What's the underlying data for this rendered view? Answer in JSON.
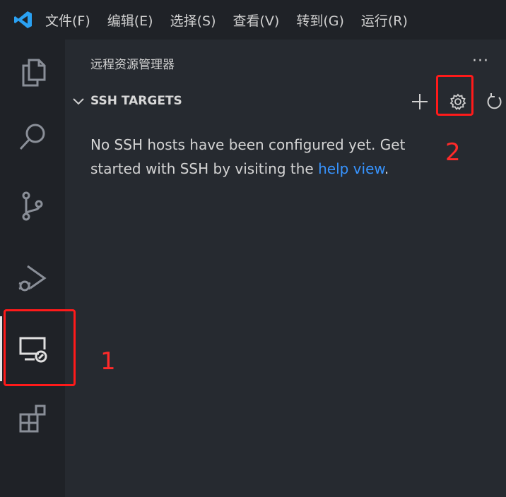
{
  "menu": {
    "items": [
      "文件(F)",
      "编辑(E)",
      "选择(S)",
      "查看(V)",
      "转到(G)",
      "运行(R)"
    ]
  },
  "activity_bar": {
    "items": [
      "explorer-icon",
      "search-icon",
      "source-control-icon",
      "run-debug-icon",
      "remote-explorer-icon",
      "extensions-icon"
    ],
    "active": "remote-explorer-icon"
  },
  "sidebar": {
    "title": "远程资源管理器",
    "more": "···",
    "section": {
      "title": "SSH TARGETS",
      "message_prefix": "No SSH hosts have been configured yet. Get started with SSH by visiting the ",
      "link_text": "help view",
      "message_suffix": "."
    }
  },
  "annotations": {
    "label_1": "1",
    "label_2": "2",
    "color": "#ff1a1a"
  },
  "colors": {
    "background": "#1f2227",
    "sidebar": "#262a30",
    "link": "#3794ff",
    "vscode_blue": "#2aa1f3"
  }
}
